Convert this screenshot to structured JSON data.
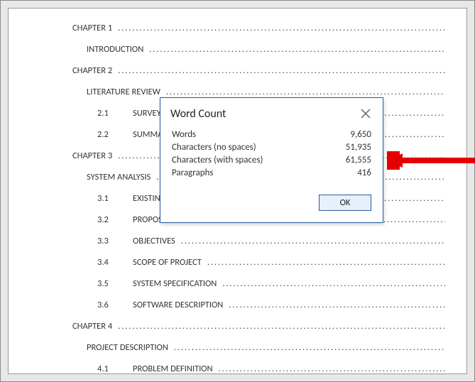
{
  "toc": [
    {
      "level": 1,
      "num": "",
      "label": "CHAPTER 1"
    },
    {
      "level": 2,
      "num": "",
      "label": "INTRODUCTION"
    },
    {
      "level": 1,
      "num": "",
      "label": "CHAPTER 2"
    },
    {
      "level": 2,
      "num": "",
      "label": "LITERATURE REVIEW"
    },
    {
      "level": 3,
      "num": "2.1",
      "label": "SURVEY"
    },
    {
      "level": 3,
      "num": "2.2",
      "label": "SUMMARY"
    },
    {
      "level": 1,
      "num": "",
      "label": "CHAPTER 3"
    },
    {
      "level": 2,
      "num": "",
      "label": "SYSTEM ANALYSIS"
    },
    {
      "level": 3,
      "num": "3.1",
      "label": "EXISTING SYSTEM"
    },
    {
      "level": 3,
      "num": "3.2",
      "label": "PROPOSED SYSTEM"
    },
    {
      "level": 3,
      "num": "3.3",
      "label": "OBJECTIVES"
    },
    {
      "level": 3,
      "num": "3.4",
      "label": "SCOPE OF PROJECT"
    },
    {
      "level": 3,
      "num": "3.5",
      "label": "SYSTEM SPECIFICATION"
    },
    {
      "level": 3,
      "num": "3.6",
      "label": "SOFTWARE DESCRIPTION"
    },
    {
      "level": 1,
      "num": "",
      "label": "CHAPTER 4"
    },
    {
      "level": 2,
      "num": "",
      "label": "PROJECT DESCRIPTION"
    },
    {
      "level": 3,
      "num": "4.1",
      "label": "PROBLEM DEFINITION"
    }
  ],
  "dialog": {
    "title": "Word Count",
    "stats": [
      {
        "label": "Words",
        "value": "9,650"
      },
      {
        "label": "Characters (no spaces)",
        "value": "51,935"
      },
      {
        "label": "Characters (with spaces)",
        "value": "61,555"
      },
      {
        "label": "Paragraphs",
        "value": "416"
      }
    ],
    "ok_label": "OK"
  },
  "annotation": {
    "arrow_color": "#e40000"
  }
}
